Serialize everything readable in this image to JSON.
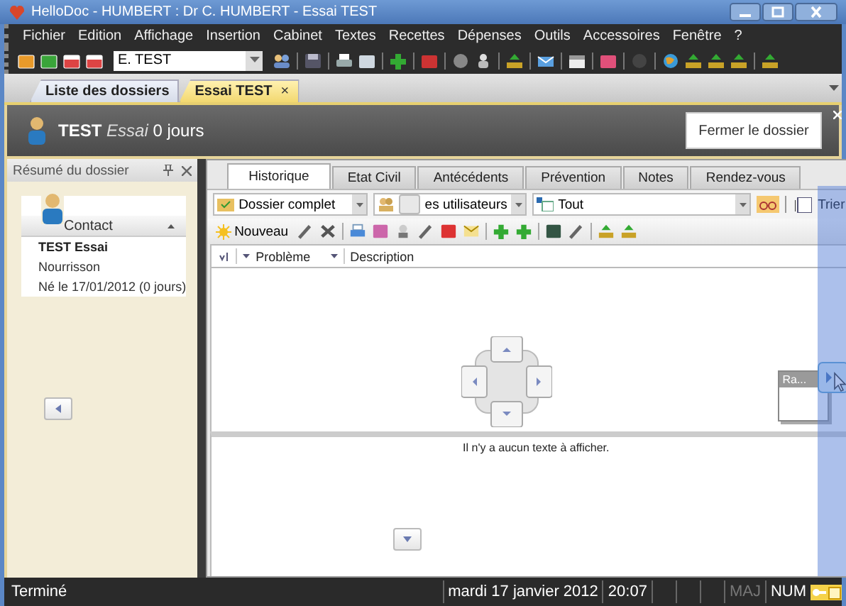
{
  "window": {
    "title": "HelloDoc - HUMBERT : Dr C. HUMBERT - Essai TEST"
  },
  "menu": [
    "Fichier",
    "Edition",
    "Affichage",
    "Insertion",
    "Cabinet",
    "Textes",
    "Recettes",
    "Dépenses",
    "Outils",
    "Accessoires",
    "Fenêtre",
    "?"
  ],
  "toolbar": {
    "patient_combo": "E. TEST"
  },
  "document_tabs": [
    {
      "label": "Liste des dossiers",
      "selected": false
    },
    {
      "label": "Essai TEST",
      "selected": true,
      "close_mark": "×"
    }
  ],
  "header": {
    "last_name": "TEST",
    "first_name": "Essai",
    "age": "0 jours",
    "close_button": "Fermer le dossier"
  },
  "summary_panel": {
    "title": "Résumé du dossier",
    "contact": {
      "heading": "Contact",
      "name": "TEST Essai",
      "category": "Nourrisson",
      "birth": "Né le 17/01/2012 (0 jours)"
    }
  },
  "record_tabs": [
    {
      "label": "Historique",
      "selected": true
    },
    {
      "label": "Etat Civil",
      "selected": false
    },
    {
      "label": "Antécédents",
      "selected": false
    },
    {
      "label": "Prévention",
      "selected": false
    },
    {
      "label": "Notes",
      "selected": false
    },
    {
      "label": "Rendez-vous",
      "selected": false
    }
  ],
  "filters": {
    "record": "Dossier complet",
    "users": "es utilisateurs",
    "scope": "Tout",
    "sort_button": "Trier"
  },
  "actions": {
    "new_button": "Nouveau"
  },
  "columns": [
    "Problème",
    "Description"
  ],
  "floating_window": {
    "title": "Ra..."
  },
  "text_pane": {
    "message": "Il n'y a aucun texte à afficher."
  },
  "status_bar": {
    "message": "Terminé",
    "date": "mardi 17 janvier 2012",
    "time": "20:07",
    "indicators": [
      {
        "label": "MAJ",
        "on": false
      },
      {
        "label": "NUM",
        "on": true
      }
    ]
  }
}
